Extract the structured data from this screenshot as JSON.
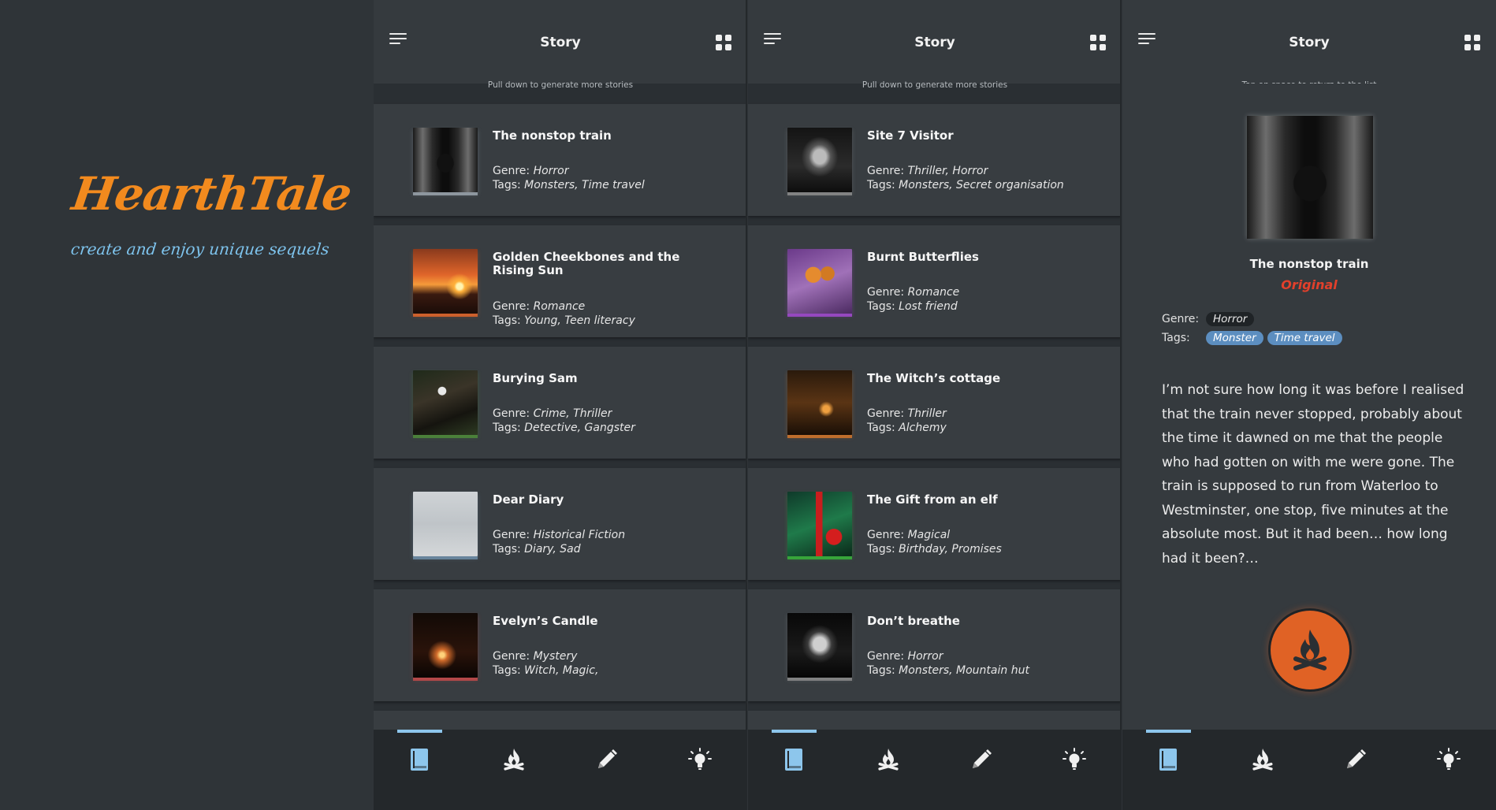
{
  "brand": {
    "name": "HearthTale",
    "tagline": "create and enjoy unique sequels"
  },
  "app": {
    "title": "Story",
    "list_hint": "Pull down to generate more stories",
    "detail_hint": "Tap on space to return to the list",
    "genre_label": "Genre:",
    "tags_label": "Tags:"
  },
  "screen1": {
    "stories": [
      {
        "title": "The nonstop train",
        "genre": "Horror",
        "tags": "Monsters, Time travel",
        "image": "subway-train",
        "glow": "#9aa3ab"
      },
      {
        "title": "Golden Cheekbones and the Rising Sun",
        "genre": "Romance",
        "tags": "Young, Teen literacy",
        "image": "sunset",
        "glow": "#e0652a"
      },
      {
        "title": "Burying Sam",
        "genre": "Crime, Thriller",
        "tags": "Detective, Gangster",
        "image": "masked-figure-forest",
        "glow": "#4e8a3a"
      },
      {
        "title": "Dear Diary",
        "genre": "Historical Fiction",
        "tags": "Diary, Sad",
        "image": "handwritten-note",
        "glow": "#6f8ea8"
      },
      {
        "title": "Evelyn’s Candle",
        "genre": "Mystery",
        "tags": "Witch, Magic,",
        "image": "candle-hand",
        "glow": "#c34a4a"
      }
    ]
  },
  "screen2": {
    "stories": [
      {
        "title": "Site 7 Visitor",
        "genre": "Thriller, Horror",
        "tags": "Monsters, Secret organisation",
        "image": "creature",
        "glow": "#8c8c8c"
      },
      {
        "title": "Burnt Butterflies",
        "genre": "Romance",
        "tags": "Lost friend",
        "image": "butterfly",
        "glow": "#a24ad0"
      },
      {
        "title": "The Witch’s cottage",
        "genre": "Thriller",
        "tags": "Alchemy",
        "image": "cottage-night",
        "glow": "#d0742a"
      },
      {
        "title": "The Gift from an elf",
        "genre": "Magical",
        "tags": "Birthday, Promises",
        "image": "christmas-gift",
        "glow": "#37b33a"
      },
      {
        "title": "Don’t breathe",
        "genre": "Horror",
        "tags": "Monsters, Mountain hut",
        "image": "screaming-face",
        "glow": "#8a8a8a"
      }
    ]
  },
  "detail": {
    "title": "The nonstop train",
    "badge": "Original",
    "genre": "Horror",
    "tags": [
      "Monster",
      "Time travel"
    ],
    "text": "I’m not sure how long it was before I realised that the train never stopped, probably about the time it dawned on me that the people who had gotten on with me were gone. The train is supposed to run from Waterloo to Westminster, one stop, five minutes at the absolute most. But it had been… how long had it been?…",
    "action_icon": "campfire-icon"
  },
  "nav": {
    "items": [
      {
        "name": "book-icon",
        "active": true
      },
      {
        "name": "campfire-icon",
        "active": false
      },
      {
        "name": "pencil-icon",
        "active": false
      },
      {
        "name": "lightbulb-icon",
        "active": false
      }
    ]
  },
  "colors": {
    "accent_orange": "#f28a1e",
    "tagline_blue": "#7ec4ee",
    "badge_red": "#e2402b",
    "fire_button": "#e06225",
    "nav_active": "#8dc6ec",
    "chip_blue": "#5c8ec0"
  }
}
